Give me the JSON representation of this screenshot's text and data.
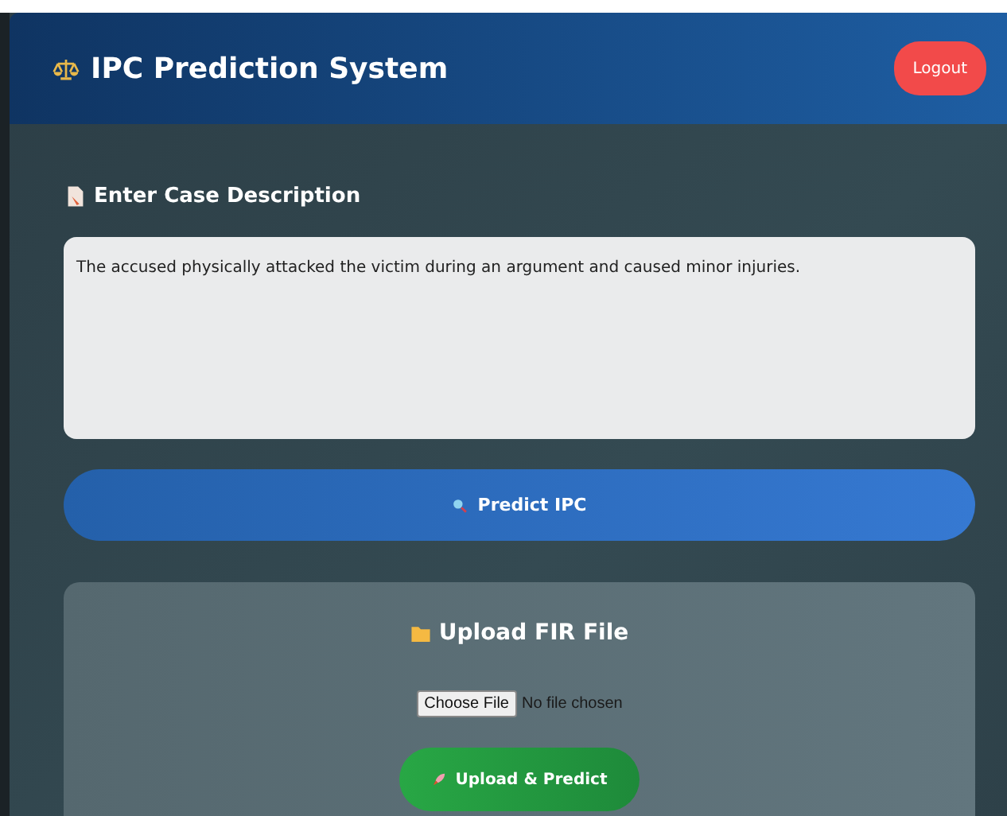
{
  "header": {
    "title": "IPC Prediction System",
    "logout_button": "Logout"
  },
  "case_section": {
    "heading": "Enter Case Description",
    "description": "The accused physically attacked the victim during an argument and caused minor injuries."
  },
  "predict_button": "Predict IPC",
  "upload_card": {
    "heading": "Upload FIR File",
    "choose_file_button": "Choose File",
    "file_status": "No file chosen",
    "upload_button": "Upload & Predict"
  }
}
